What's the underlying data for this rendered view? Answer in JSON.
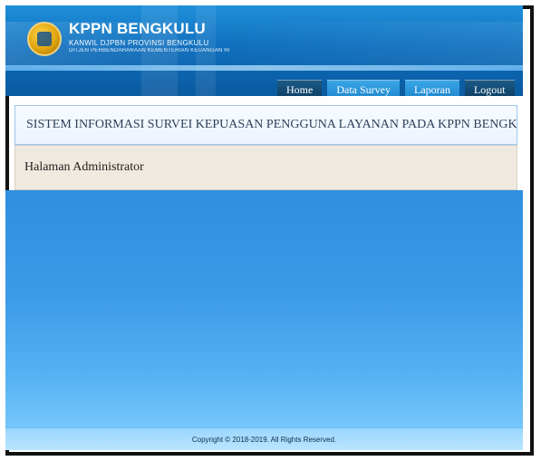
{
  "header": {
    "name": "KPPN BENGKULU",
    "subtitle": "KANWIL DJPBN PROVINSI BENGKULU",
    "subtitle2": "DITJEN PERBENDAHARAAN KEMENTERIAN KEUANGAN RI"
  },
  "nav": {
    "items": [
      {
        "label": "Home"
      },
      {
        "label": "Data Survey"
      },
      {
        "label": "Laporan"
      },
      {
        "label": "Logout"
      }
    ]
  },
  "page": {
    "title": "SISTEM INFORMASI SURVEI KEPUASAN PENGGUNA LAYANAN PADA KPPN BENGKULU",
    "section": "Halaman Administrator"
  },
  "footer": {
    "text": "Copyright © 2018-2019. All Rights Reserved."
  }
}
